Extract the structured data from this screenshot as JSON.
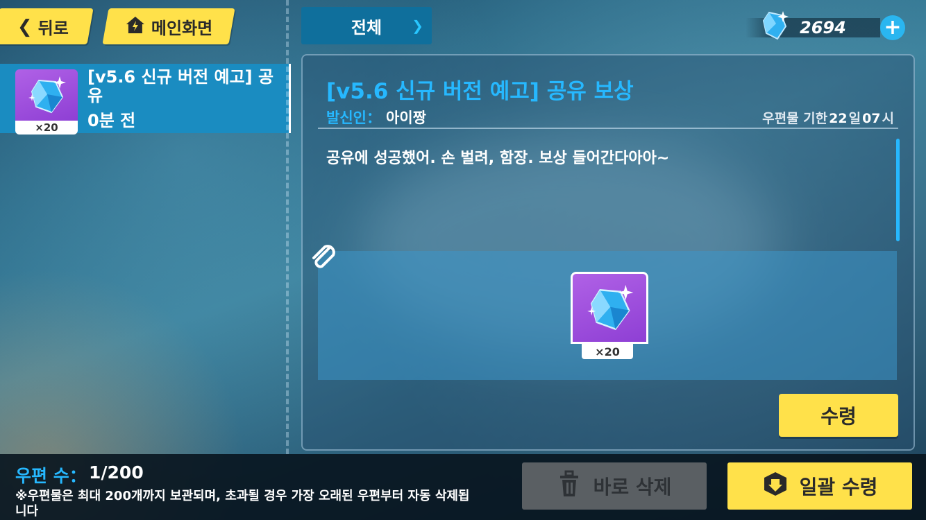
{
  "nav": {
    "back_label": "뒤로",
    "home_label": "메인화면"
  },
  "filter": {
    "selected": "전체"
  },
  "currency": {
    "amount": "2694",
    "icon": "crystal-icon",
    "add_icon": "plus-icon"
  },
  "mail_list": {
    "items": [
      {
        "title": "[v5.6 신규 버전 예고] 공유",
        "time": "0분 전",
        "reward_count": "×20",
        "icon": "crystal-icon"
      }
    ]
  },
  "detail": {
    "title": "[v5.6 신규 버전 예고] 공유 보상",
    "sender_label": "발신인：",
    "sender": "아이짱",
    "expire_label": "우편물 기한",
    "expire_days": "22",
    "expire_days_unit": "일",
    "expire_hours": "07",
    "expire_hours_unit": "시",
    "body": "공유에 성공했어. 손 벌려, 함장. 보상 들어간다아아~",
    "reward_count": "×20",
    "claim_label": "수령"
  },
  "footer": {
    "mail_count_label": "우편 수：",
    "mail_count": "1/200",
    "notice": "※우편물은 최대 200개까지 보관되며, 초과될 경우 가장 오래된 우편부터 자동 삭제됩니다",
    "delete_label": "바로 삭제",
    "claim_all_label": "일괄 수령"
  },
  "colors": {
    "accent": "#26b8ff",
    "button_yellow": "#ffe14a",
    "item_purple": "#9b4ddc"
  }
}
